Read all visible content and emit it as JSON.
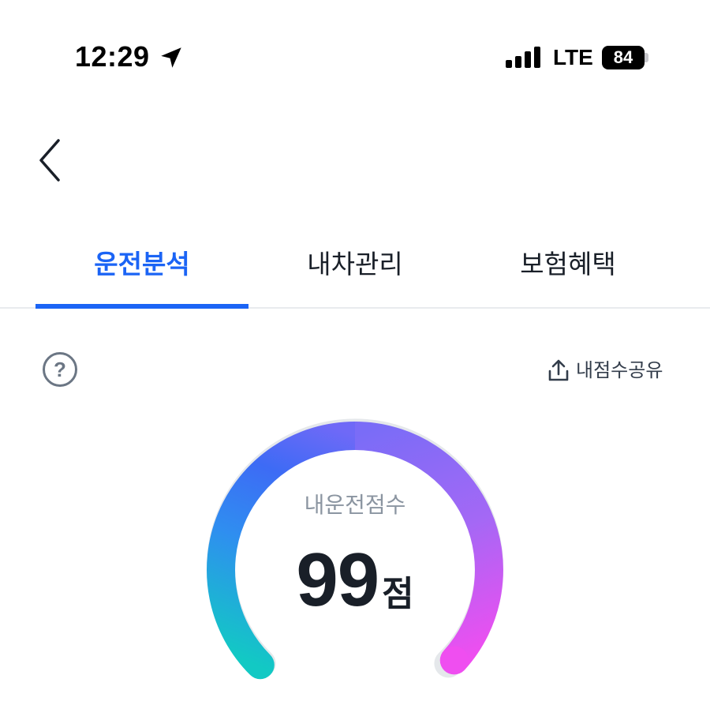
{
  "status_bar": {
    "time": "12:29",
    "network": "LTE",
    "battery": "84",
    "icons": [
      "location-arrow-icon",
      "cellular-signal-icon",
      "battery-icon"
    ]
  },
  "nav": {
    "back_icon": "chevron-left-icon"
  },
  "tabs": [
    {
      "label": "운전분석",
      "active": true
    },
    {
      "label": "내차관리",
      "active": false
    },
    {
      "label": "보험혜택",
      "active": false
    }
  ],
  "toolbar": {
    "help_icon": "question-circle-icon",
    "help_mark": "?",
    "share_icon": "share-upload-icon",
    "share_label": "내점수공유"
  },
  "score": {
    "label": "내운전점수",
    "value": "99",
    "unit": "점",
    "fraction": 0.99
  },
  "colors": {
    "accent": "#1b64f5",
    "gauge_start": "#12c9c4",
    "gauge_mid_left": "#3d6bf5",
    "gauge_top": "#7a6cf7",
    "gauge_end": "#ef4ef0",
    "gauge_track": "#e5e8eb",
    "text_primary": "#191f28",
    "text_secondary": "#8b95a1"
  }
}
